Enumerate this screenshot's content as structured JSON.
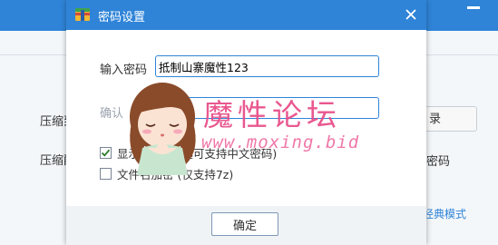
{
  "background": {
    "left_labels": [
      "压缩到",
      "压缩配"
    ],
    "right_button_label": "录",
    "right_text": "密码",
    "link": "经典模式"
  },
  "dialog": {
    "title": "密码设置",
    "password_label": "输入密码",
    "password_value": "抵制山寨魔性123",
    "confirm_label": "确认",
    "show_password_label": "显示密码 (勾选可支持中文密码)",
    "show_password_checked": true,
    "encrypt_filenames_label": "文件名加密 (仅支持7z)",
    "encrypt_filenames_checked": false,
    "ok_label": "确定"
  },
  "watermark": {
    "title": "魔性论坛",
    "url": "www.moxing.bid"
  },
  "colors": {
    "accent": "#2f84d8",
    "watermark_pink": "#e84a86"
  },
  "icons": [
    "archive-icon",
    "close-icon",
    "checkmark-icon",
    "minimize-icon"
  ]
}
